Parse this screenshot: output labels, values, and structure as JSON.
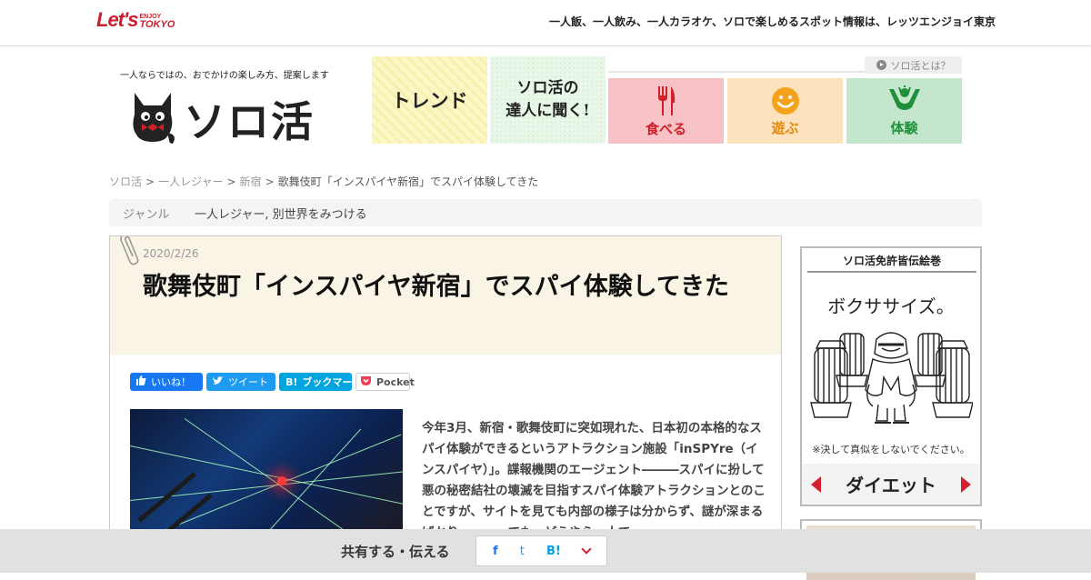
{
  "topbar": {
    "logo": {
      "main": "Let's",
      "enjoy": "ENJOY",
      "tokyo": "TOKYO"
    },
    "tagline": "一人飯、一人飲み、一人カラオケ、ソロで楽しめるスポット情報は、レッツエンジョイ東京"
  },
  "brand": {
    "catchphrase": "一人ならではの、おでかけの楽しみ方、提案します",
    "name": "ソロ活"
  },
  "nav": {
    "trend": "トレンド",
    "expert_line1": "ソロ活の",
    "expert_line2": "達人に聞く!",
    "categories": [
      {
        "label": "食べる",
        "icon": "fork-knife-icon",
        "color": "#d0202a"
      },
      {
        "label": "遊ぶ",
        "icon": "smile-icon",
        "color": "#e48a12"
      },
      {
        "label": "体験",
        "icon": "cheer-icon",
        "color": "#1f8f3a"
      }
    ],
    "about": "ソロ活とは？"
  },
  "breadcrumb": {
    "items": [
      "ソロ活",
      "一人レジャー",
      "新宿"
    ],
    "separator": ">",
    "current": "歌舞伎町「インスパイヤ新宿」でスパイ体験してきた"
  },
  "genre": {
    "label": "ジャンル",
    "value": "一人レジャー, 別世界をみつける"
  },
  "article": {
    "date": "2020/2/26",
    "title": "歌舞伎町「インスパイヤ新宿」でスパイ体験してきた",
    "share_buttons": {
      "facebook": "いいね！",
      "twitter": "ツイート",
      "hatena_icon": "B!",
      "hatena": "ブックマーク",
      "pocket": "Pocket"
    },
    "body": "今年3月、新宿・歌舞伎町に突如現れた、日本初の本格的なスパイ体験ができるというアトラクション施設「inSPYre（インスパイヤ）」。諜報機関のエージェント―――スパイに扮して悪の秘密結社の壊滅を目指すスパイ体験アトラクションとのことですが、サイトを見ても内部の様子は分からず、謎が深まるばかり・・・。でも、どうやら一人で"
  },
  "sidebar": {
    "ad_title": "ソロ活免許皆伝絵巻",
    "ad_heading": "ボクササイズ。",
    "ad_note": "※決して真似をしないでください。",
    "ad_nav_label": "ダイエット"
  },
  "share_bar": {
    "label": "共有する・伝える",
    "facebook": "f",
    "twitter": "t",
    "hatena": "B!"
  },
  "colors": {
    "brand_red": "#d0202a",
    "eat_bg": "#f6c2c6",
    "play_bg": "#fce2bd",
    "experience_bg": "#c4e6cd",
    "article_head_bg": "#faf4e6"
  }
}
